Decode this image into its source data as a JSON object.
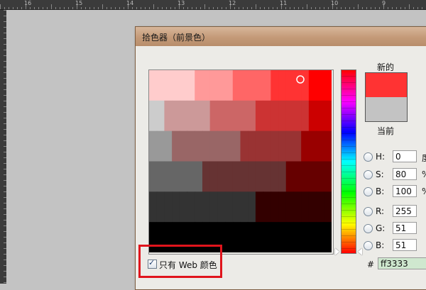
{
  "ruler": {
    "top_labels": [
      "16",
      "15",
      "14",
      "13",
      "12",
      "11",
      "10",
      "9",
      "8"
    ]
  },
  "dialog": {
    "title": "拾色器（前景色）",
    "new_label": "新的",
    "current_label": "当前",
    "new_color": "#ff3333",
    "current_color": "#c3c3c3",
    "fields": [
      {
        "key": "H",
        "label": "H:",
        "value": "0",
        "unit": "度",
        "checked": true
      },
      {
        "key": "S",
        "label": "S:",
        "value": "80",
        "unit": "%",
        "checked": false
      },
      {
        "key": "B",
        "label": "B:",
        "value": "100",
        "unit": "%",
        "checked": false
      },
      {
        "key": "R",
        "label": "R:",
        "value": "255",
        "unit": "",
        "checked": false
      },
      {
        "key": "G",
        "label": "G:",
        "value": "51",
        "unit": "",
        "checked": false
      },
      {
        "key": "Bl",
        "label": "B:",
        "value": "51",
        "unit": "",
        "checked": false
      }
    ],
    "hex_prefix": "#",
    "hex_value": "ff3333",
    "web_only_label": "只有 Web 颜色",
    "web_only_checked": true,
    "web_only_mark": "✓",
    "field_hue_color": "#ff0000",
    "highlight_color": "#e0141c"
  }
}
